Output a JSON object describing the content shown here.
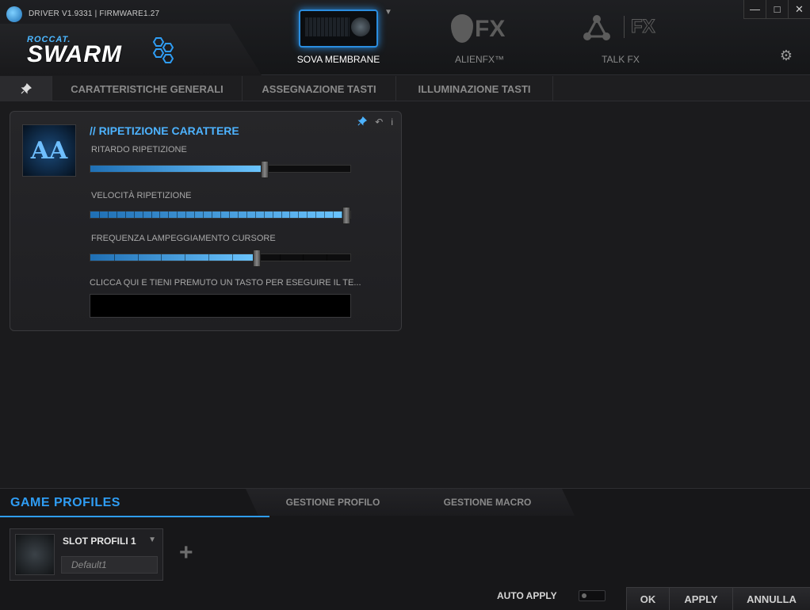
{
  "header": {
    "version": "DRIVER V1.9331 | FIRMWARE1.27",
    "brand_small": "ROCCAT.",
    "brand_big": "SWARM",
    "devices": [
      {
        "label": "SOVA MEMBRANE",
        "active": true
      },
      {
        "label": "ALIENFX™",
        "active": false
      },
      {
        "label": "TALK FX",
        "active": false
      }
    ],
    "alien_fx_text": "FX",
    "talk_fx_text": "FX",
    "window_buttons": {
      "minimize": "—",
      "maximize": "□",
      "close": "✕"
    },
    "settings_icon": "gear-icon"
  },
  "tabs": {
    "pin_icon": "pin-icon",
    "items": [
      "CARATTERISTICHE GENERALI",
      "ASSEGNAZIONE TASTI",
      "ILLUMINAZIONE TASTI"
    ]
  },
  "panel": {
    "icon_text": "AA",
    "title": "// RIPETIZIONE CARATTERE",
    "tools": [
      "pin-icon",
      "undo-icon",
      "info-icon"
    ],
    "sliders": [
      {
        "label": "RITARDO RIPETIZIONE",
        "value": 0.67,
        "segments": 0
      },
      {
        "label": "VELOCITÀ RIPETIZIONE",
        "value": 1.0,
        "segments": 30
      },
      {
        "label": "FREQUENZA LAMPEGGIAMENTO CURSORE",
        "value": 0.64,
        "segments": 11
      }
    ],
    "test_label": "CLICCA QUI E TIENI PREMUTO UN TASTO PER ESEGUIRE IL TE...",
    "test_value": ""
  },
  "game_profiles": {
    "title": "GAME PROFILES",
    "tabs": [
      "GESTIONE PROFILO",
      "GESTIONE MACRO"
    ],
    "slot_name": "SLOT PROFILI 1",
    "slot_value": "Default1",
    "add_symbol": "+",
    "auto_apply_label": "AUTO APPLY",
    "auto_apply_on": false,
    "buttons": {
      "ok": "OK",
      "apply": "APPLY",
      "cancel": "ANNULLA"
    }
  },
  "colors": {
    "accent": "#2f9df4",
    "slider_start": "#1f6fb4",
    "slider_end": "#6cc6ff"
  }
}
